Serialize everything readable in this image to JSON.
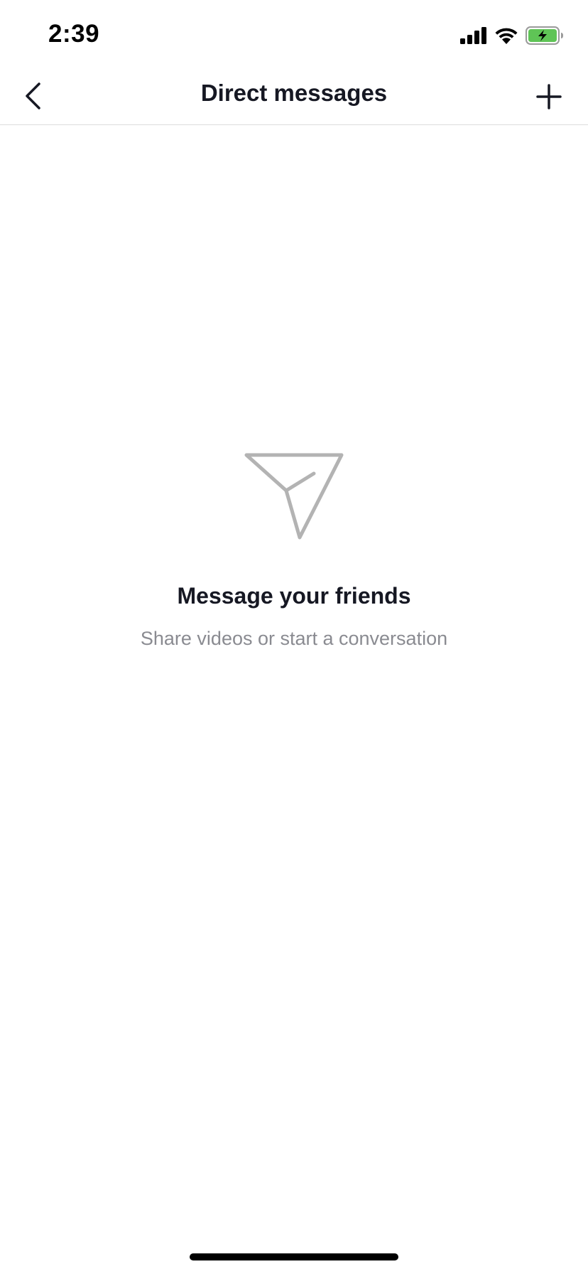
{
  "status_bar": {
    "time": "2:39",
    "icons": [
      "cellular-signal-icon",
      "wifi-icon",
      "battery-charging-icon"
    ],
    "battery_color": "#5fc456"
  },
  "header": {
    "title": "Direct messages",
    "back_icon": "chevron-left-icon",
    "add_icon": "plus-icon"
  },
  "empty_state": {
    "icon": "paper-plane-icon",
    "title": "Message your friends",
    "subtitle": "Share videos or start a conversation",
    "icon_color": "#b3b3b3"
  }
}
